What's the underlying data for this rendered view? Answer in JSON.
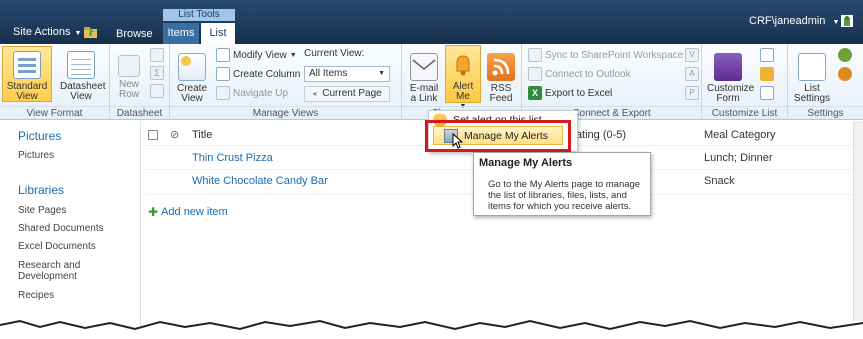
{
  "topbar": {
    "context_label": "List Tools",
    "site_actions": "Site Actions",
    "tab_browse": "Browse",
    "tab_items": "Items",
    "tab_list": "List",
    "user": "CRF\\janeadmin"
  },
  "ribbon": {
    "view_format": {
      "label": "View Format",
      "standard_view": "Standard View",
      "datasheet_view": "Datasheet View"
    },
    "datasheet": {
      "label": "Datasheet",
      "new_row": "New Row"
    },
    "manage_views": {
      "label": "Manage Views",
      "create_view": "Create View",
      "modify_view": "Modify View",
      "create_column": "Create Column",
      "navigate_up": "Navigate Up",
      "current_view_label": "Current View:",
      "current_view_value": "All Items",
      "current_page": "Current Page"
    },
    "share_track": {
      "label": "Sha",
      "email_link": "E-mail a Link",
      "alert_me": "Alert Me",
      "rss_feed": "RSS Feed"
    },
    "connect_export": {
      "label": "Connect & Export",
      "sync": "Sync to SharePoint Workspace",
      "connect_outlook": "Connect to Outlook",
      "export_excel": "Export to Excel"
    },
    "customize_list": {
      "label": "Customize List",
      "customize_form": "Customize Form"
    },
    "settings": {
      "label": "Settings",
      "list_settings": "List Settings"
    }
  },
  "leftnav": {
    "pictures_heading": "Pictures",
    "pictures_item": "Pictures",
    "libraries_heading": "Libraries",
    "items": [
      "Site Pages",
      "Shared Documents",
      "Excel Documents",
      "Research and",
      "Development",
      "Recipes"
    ]
  },
  "list": {
    "col_title": "Title",
    "col_rating": "Rating (0-5)",
    "col_meal": "Meal Category",
    "rows": [
      {
        "title": "Thin Crust Pizza",
        "meal": "Lunch; Dinner"
      },
      {
        "title": "White Chocolate Candy Bar",
        "meal": "Snack"
      }
    ],
    "add_new": "Add new item"
  },
  "dropdown": {
    "set_alert": "Set alert on this list",
    "manage_alerts": "Manage My Alerts"
  },
  "tooltip": {
    "title": "Manage My Alerts",
    "desc": "Go to the My Alerts page to manage the list of libraries, files, lists, and items for which you receive alerts."
  },
  "colors": {
    "topbar": "#1e3a5c",
    "link": "#1a6bb0",
    "highlight_border": "#d7191c"
  }
}
